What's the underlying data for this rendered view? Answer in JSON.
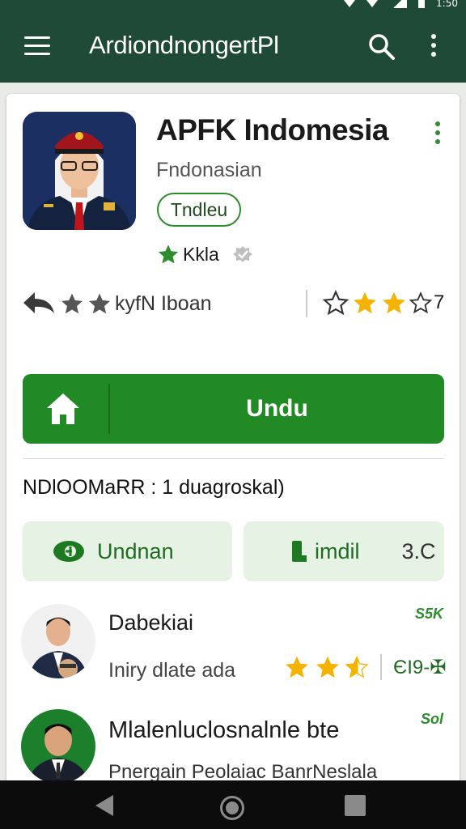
{
  "status": {
    "time": "1:50"
  },
  "appbar": {
    "title": "Ardiondnongert​Pl"
  },
  "app": {
    "name": "APFK Indomesia",
    "subtitle": "Fndonasian",
    "chip": "Tndleu",
    "badge": "Kkla",
    "rating_left_text": "kyfN Iboan",
    "rating_right_num": "7"
  },
  "install": {
    "label": "Undu"
  },
  "info": {
    "text": "NDlOOMaRR : 1 duagroskal)"
  },
  "pills": {
    "left": "Undnan",
    "right": "imdil",
    "right_value": "3.C"
  },
  "list": [
    {
      "title": "Dabekiai",
      "subtitle": "Iniry dlate ada",
      "tag": "S5K",
      "count": "ЄI9-✠"
    },
    {
      "title": "Mlalenluclosnalnle bte",
      "subtitle": "Pnergain Peolaiac BanrNeslala",
      "tag": "Sol"
    }
  ],
  "colors": {
    "primary": "#1f4a37",
    "accent": "#218a24",
    "star": "#f5b301",
    "pill": "#e6f2e4"
  }
}
